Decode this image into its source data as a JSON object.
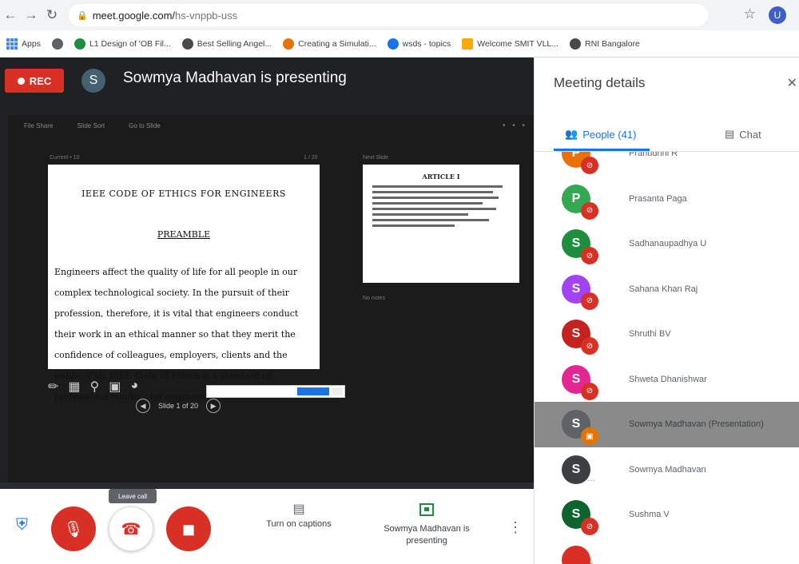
{
  "browser": {
    "url_host": "meet.google.com/",
    "url_path": "hs-vnppb-uss",
    "profile_initial": "U",
    "bookmarks": [
      {
        "label": "Apps"
      },
      {
        "label": ""
      },
      {
        "label": "L1 Design of 'OB Fil...",
        "color": "#1e8e3e"
      },
      {
        "label": "Best Selling Angel...",
        "color": "#4a4a4a"
      },
      {
        "label": "Creating a Simulati...",
        "color": "#e8710a"
      },
      {
        "label": "wsds - topics",
        "color": "#1a73e8"
      },
      {
        "label": "Welcome SMIT VLL...",
        "color": "#f9ab00"
      },
      {
        "label": "RNI Bangalore",
        "color": "#4a4a4a"
      }
    ]
  },
  "meet": {
    "rec_label": "REC",
    "presenter_initial": "S",
    "presenting_title": "Sowmya Madhavan is presenting",
    "share_menu": [
      "File Share",
      "Slide Sort",
      "Go to Slide"
    ],
    "slide_label": "Current • 10",
    "slide_count": "1 / 20",
    "slide": {
      "title": "IEEE CODE OF ETHICS FOR ENGINEERS",
      "subtitle": "PREAMBLE",
      "body": "Engineers affect the quality of life for all people in our complex technological society. In the pursuit of their profession, therefore, it is vital that engineers conduct their work in an ethical manner so that they merit the confidence of colleagues, employers, clients and the public. This IEEE Code of Ethics is a standard of professional conduct for engineers."
    },
    "slide_nav_label": "Slide 1 of 20",
    "next_label": "Next Slide",
    "next_slide_title": "ARTICLE I",
    "notes_label": "No notes",
    "tooltip": "Leave call",
    "captions_label": "Turn on captions",
    "presenting_label": "Sowmya Madhavan is presenting"
  },
  "panel": {
    "title": "Meeting details",
    "tab_people": "People (41)",
    "tab_chat": "Chat",
    "people": [
      {
        "initial": "P",
        "name": "Pranudhni R",
        "color": "#e8710a",
        "state": "muted"
      },
      {
        "initial": "P",
        "name": "Prasanta Paga",
        "color": "#34a853",
        "state": "muted"
      },
      {
        "initial": "S",
        "name": "Sadhanaupadhya U",
        "color": "#1e8e3e",
        "state": "muted"
      },
      {
        "initial": "S",
        "name": "Sahana Khan Raj",
        "color": "#a142f4",
        "state": "muted"
      },
      {
        "initial": "S",
        "name": "Shruthi BV",
        "color": "#c5221f",
        "state": "muted"
      },
      {
        "initial": "S",
        "name": "Shweta Dhanishwar",
        "color": "#e52592",
        "state": "muted"
      },
      {
        "initial": "S",
        "name": "Sowmya Madhavan (Presentation)",
        "color": "#5f6368",
        "state": "presenting"
      },
      {
        "initial": "S",
        "name": "Sowmya Madhavan",
        "color": "#3c4043",
        "state": "speaking"
      },
      {
        "initial": "S",
        "name": "Sushma V",
        "color": "#0d652d",
        "state": "muted"
      },
      {
        "initial": "",
        "name": "",
        "color": "#d93025",
        "state": "muted"
      }
    ]
  },
  "colors": {
    "accent": "#1a73e8",
    "danger": "#d93025",
    "meet_bg": "#202124"
  },
  "icons": {
    "back": "arrow-left-icon",
    "forward": "arrow-right-icon",
    "reload": "reload-icon",
    "star": "star-icon",
    "mic_off": "mic-off-icon",
    "hang_up": "phone-hangup-icon",
    "cam_off": "camera-off-icon",
    "captions": "captions-icon",
    "present": "present-icon",
    "more": "more-vert-icon",
    "people": "people-icon",
    "chat": "chat-icon",
    "shield": "shield-icon"
  }
}
